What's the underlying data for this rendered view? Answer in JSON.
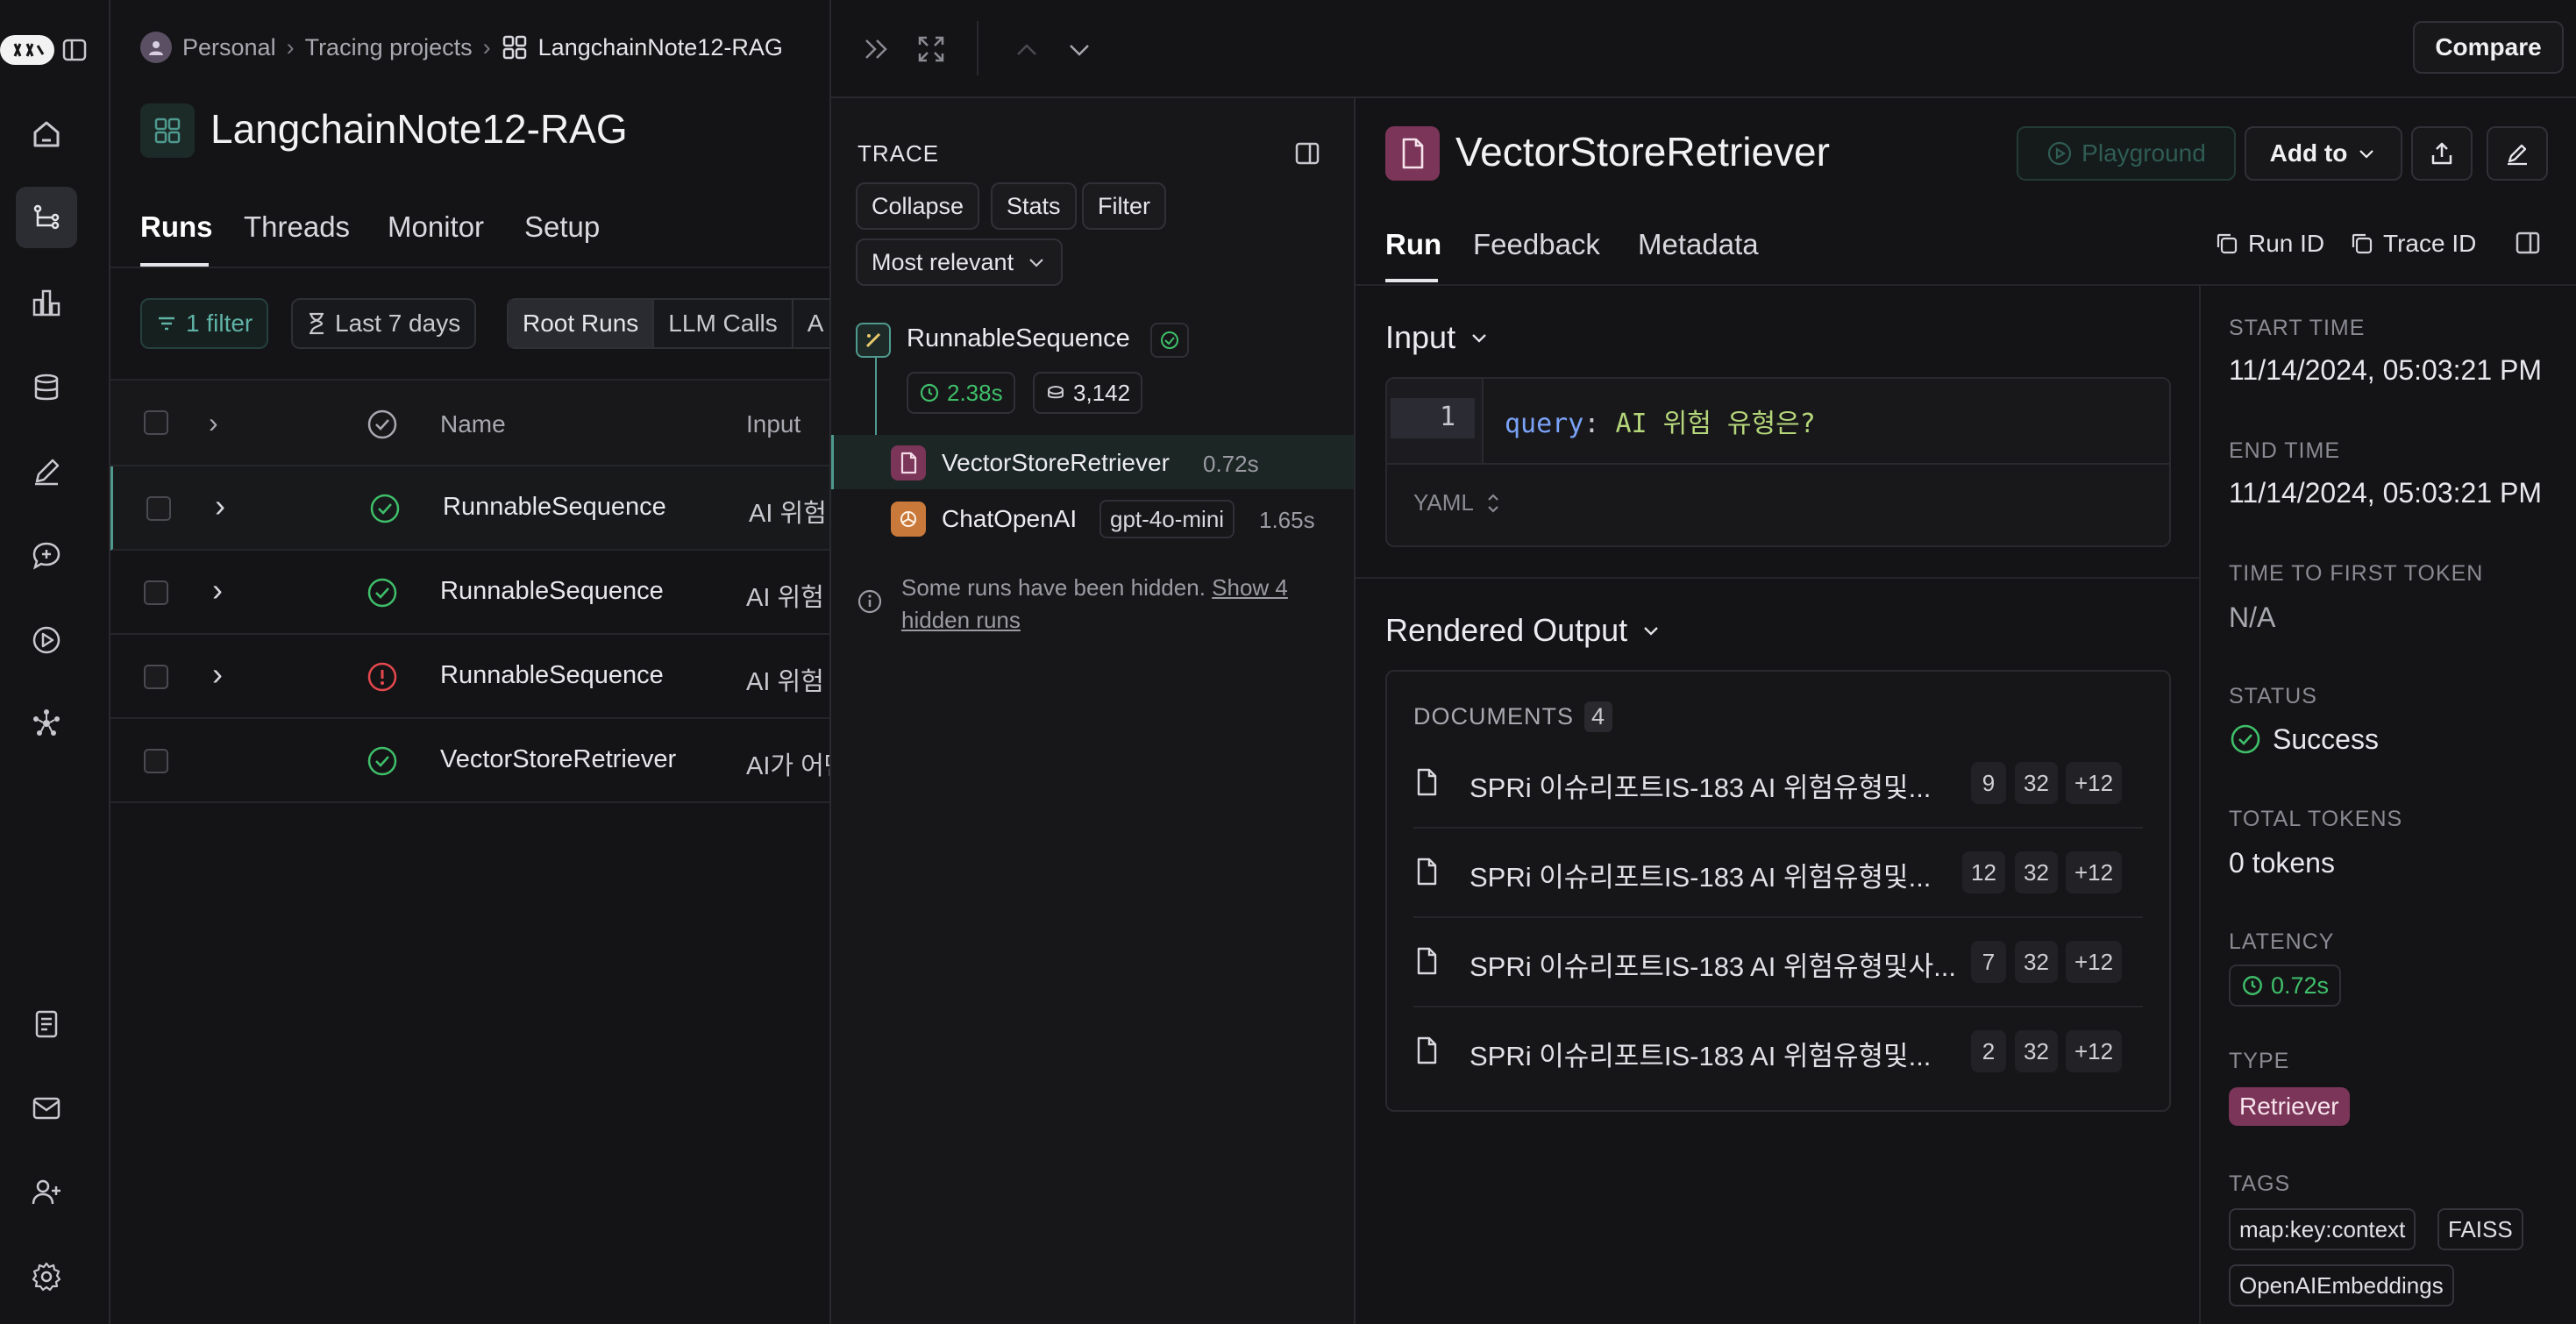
{
  "breadcrumb": {
    "personal": "Personal",
    "projects": "Tracing projects",
    "current": "LangchainNote12-RAG"
  },
  "project": {
    "title": "LangchainNote12-RAG",
    "tabs": [
      "Runs",
      "Threads",
      "Monitor",
      "Setup"
    ],
    "active_tab": "Runs"
  },
  "filters": {
    "filter": "1 filter",
    "time": "Last 7 days",
    "segments": [
      "Root Runs",
      "LLM Calls",
      "A"
    ]
  },
  "table": {
    "columns": {
      "name": "Name",
      "input": "Input"
    },
    "rows": [
      {
        "name": "RunnableSequence",
        "input": "AI 위험",
        "status": "success",
        "expandable": true
      },
      {
        "name": "RunnableSequence",
        "input": "AI 위험",
        "status": "success",
        "expandable": true
      },
      {
        "name": "RunnableSequence",
        "input": "AI 위험",
        "status": "error",
        "expandable": true
      },
      {
        "name": "VectorStoreRetriever",
        "input": "AI가 어떤",
        "status": "success",
        "expandable": false
      }
    ]
  },
  "trace": {
    "title": "TRACE",
    "buttons": [
      "Collapse",
      "Stats",
      "Filter"
    ],
    "sort": "Most relevant",
    "root": {
      "name": "RunnableSequence",
      "latency": "2.38s",
      "tokens": "3,142"
    },
    "children": [
      {
        "name": "VectorStoreRetriever",
        "latency": "0.72s",
        "model": ""
      },
      {
        "name": "ChatOpenAI",
        "latency": "1.65s",
        "model": "gpt-4o-mini"
      }
    ],
    "hidden_note": "Some runs have been hidden.",
    "hidden_link_1": "Show 4",
    "hidden_link_2": "hidden runs"
  },
  "topbar": {
    "compare": "Compare"
  },
  "detail": {
    "title": "VectorStoreRetriever",
    "playground": "Playground",
    "add_to": "Add to",
    "tabs": [
      "Run",
      "Feedback",
      "Metadata"
    ],
    "active_tab": "Run",
    "run_id": "Run ID",
    "trace_id": "Trace ID",
    "input_section": "Input",
    "code_line_no": "1",
    "code_key": "query",
    "code_sep": ":",
    "code_value": "AI 위험 유형은?",
    "format": "YAML",
    "output_section": "Rendered Output",
    "documents_label": "DOCUMENTS",
    "documents_count": "4",
    "documents": [
      {
        "title": "SPRi 이슈리포트IS-183 AI 위험유형및...",
        "c1": "9",
        "c2": "32",
        "c3": "+12"
      },
      {
        "title": "SPRi 이슈리포트IS-183 AI 위험유형및...",
        "c1": "12",
        "c2": "32",
        "c3": "+12"
      },
      {
        "title": "SPRi 이슈리포트IS-183 AI 위험유형및사...",
        "c1": "7",
        "c2": "32",
        "c3": "+12"
      },
      {
        "title": "SPRi 이슈리포트IS-183 AI 위험유형및...",
        "c1": "2",
        "c2": "32",
        "c3": "+12"
      }
    ]
  },
  "meta": {
    "start_time_label": "START TIME",
    "start_time": "11/14/2024, 05:03:21 PM",
    "end_time_label": "END TIME",
    "end_time": "11/14/2024, 05:03:21 PM",
    "ttft_label": "TIME TO FIRST TOKEN",
    "ttft": "N/A",
    "status_label": "STATUS",
    "status": "Success",
    "tokens_label": "TOTAL TOKENS",
    "tokens": "0 tokens",
    "latency_label": "LATENCY",
    "latency": "0.72s",
    "type_label": "TYPE",
    "type": "Retriever",
    "tags_label": "TAGS",
    "tags": [
      "map:key:context",
      "FAISS",
      "OpenAIEmbeddings"
    ]
  },
  "colors": {
    "success": "#3fbf6a",
    "error": "#e5484d",
    "retriever": "#7a3558",
    "accent": "#4f9a8f",
    "code_key": "#7aa2f7",
    "code_value": "#b5d67a"
  },
  "icons": {
    "nav": [
      "home-icon",
      "tracing-icon",
      "dashboard-icon",
      "datasets-icon",
      "annotation-icon",
      "prompts-icon",
      "playground-icon",
      "deployments-icon",
      "docs-icon",
      "mail-icon",
      "add-user-icon",
      "settings-icon"
    ]
  }
}
